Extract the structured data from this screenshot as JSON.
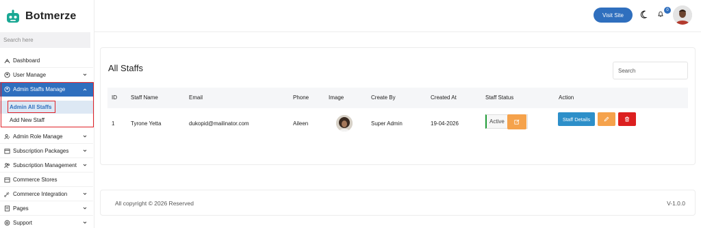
{
  "app": {
    "brand_name": "Botmerze",
    "brand_color": "#1aa894",
    "accent_color": "#2f6fbe"
  },
  "sidebar": {
    "search_placeholder": "Search here",
    "items": [
      {
        "label": "Dashboard",
        "icon": "dashboard-icon",
        "has_chevron": false
      },
      {
        "label": "User Manage",
        "icon": "user-circle-icon",
        "has_chevron": true
      },
      {
        "label": "Admin Staffs Manage",
        "icon": "user-circle-icon",
        "has_chevron": true,
        "active": true,
        "submenu": [
          {
            "label": "Admin All Staffs",
            "active": true
          },
          {
            "label": "Add New Staff",
            "active": false
          }
        ]
      },
      {
        "label": "Admin Role Manage",
        "icon": "user-role-icon",
        "has_chevron": true
      },
      {
        "label": "Subscription Packages",
        "icon": "package-icon",
        "has_chevron": true
      },
      {
        "label": "Subscription Management",
        "icon": "users-group-icon",
        "has_chevron": true
      },
      {
        "label": "Commerce Stores",
        "icon": "store-icon",
        "has_chevron": false
      },
      {
        "label": "Commerce Integration",
        "icon": "plug-icon",
        "has_chevron": true
      },
      {
        "label": "Pages",
        "icon": "pages-icon",
        "has_chevron": true
      },
      {
        "label": "Support",
        "icon": "support-icon",
        "has_chevron": true
      }
    ]
  },
  "header": {
    "visit_site_label": "Visit Site",
    "notification_count": "0"
  },
  "main": {
    "title": "All Staffs",
    "search_placeholder": "Search",
    "columns": [
      "ID",
      "Staff Name",
      "Email",
      "Phone",
      "Image",
      "Create By",
      "Created At",
      "Staff Status",
      "Action"
    ],
    "rows": [
      {
        "id": "1",
        "staff_name": "Tyrone Yetta",
        "email": "dukopid@mailinator.com",
        "phone": "Aileen",
        "create_by": "Super Admin",
        "created_at": "19-04-2026",
        "status": "Active",
        "actions": {
          "details_label": "Staff Details"
        }
      }
    ],
    "status_color": "#1e9b35",
    "edit_color": "#f5a24b",
    "delete_color": "#dc1f1f",
    "details_color": "#2d8fc9"
  },
  "footer": {
    "copyright": "All copyright © 2026 Reserved",
    "version": "V-1.0.0"
  }
}
